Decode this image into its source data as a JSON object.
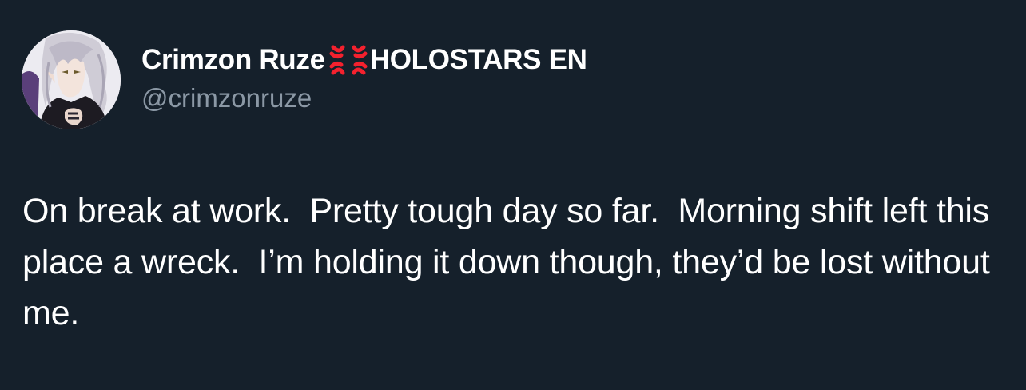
{
  "author": {
    "display_name": "Crimzon Ruze",
    "name_icon": "anger-symbol-icon",
    "affiliation": "HOLOSTARS EN",
    "handle": "@crimzonruze",
    "avatar": "profile-avatar"
  },
  "tweet": {
    "text": "On break at work.  Pretty tough day so far.  Morning shift left this place a wreck.  I’m holding it down though, they’d be lost without me."
  },
  "colors": {
    "background": "#15202b",
    "primary_text": "#ffffff",
    "secondary_text": "#8b98a5",
    "anger_icon": "#f4212e"
  }
}
